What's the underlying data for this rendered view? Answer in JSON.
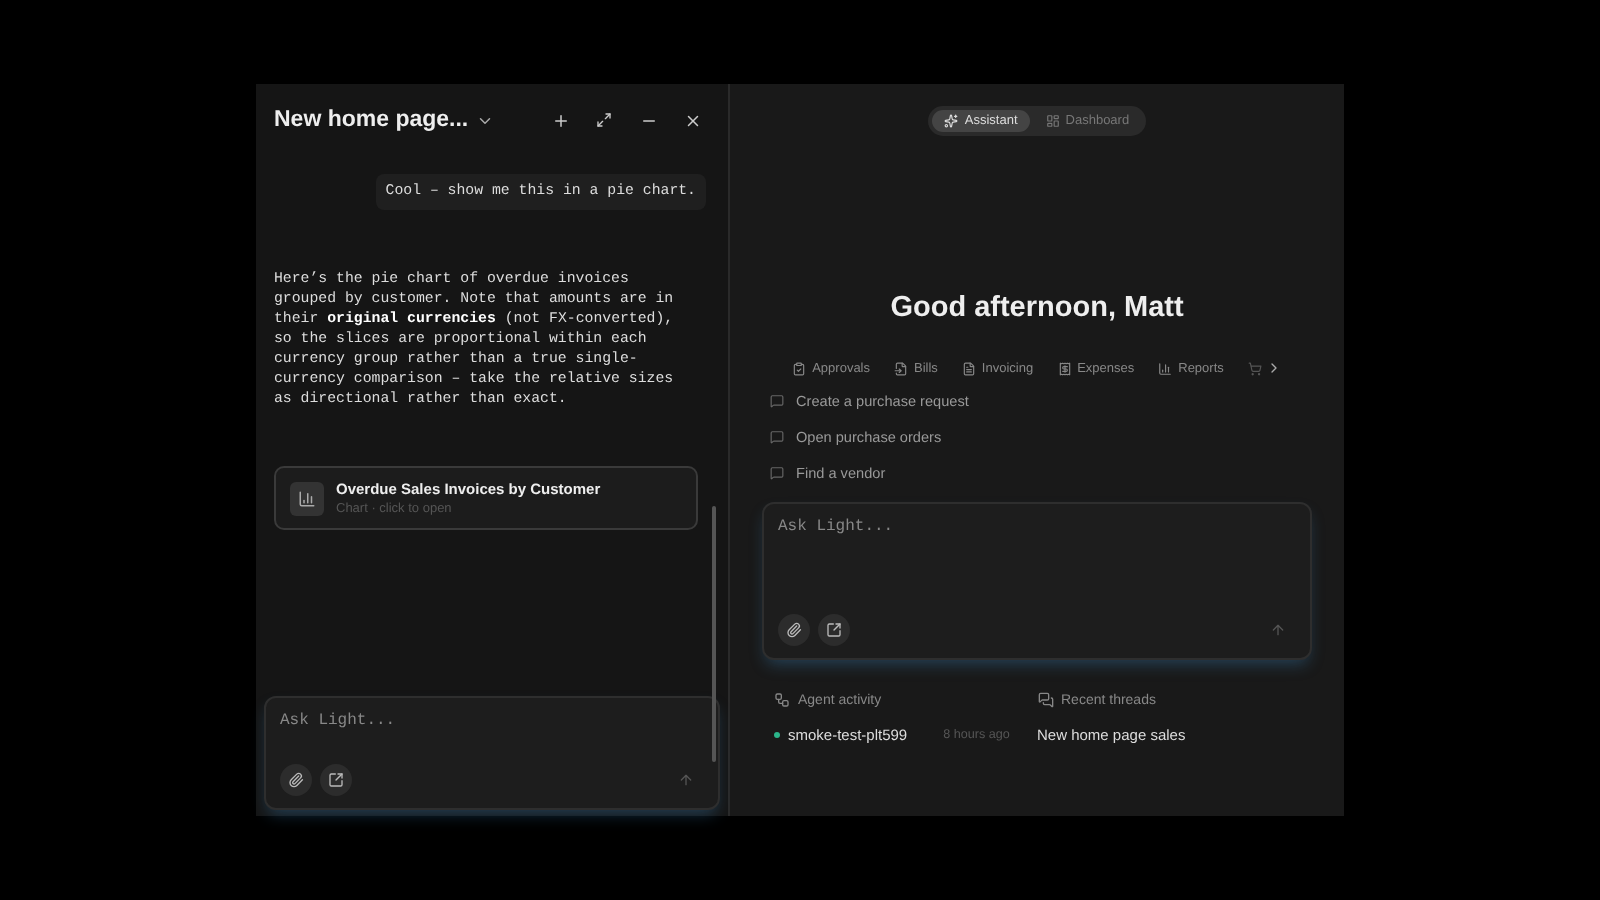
{
  "chat_panel": {
    "title": "New home page...",
    "user_message": "Cool – show me this in a pie chart.",
    "assistant_message": "Here’s the pie chart of overdue invoices grouped by customer. Note that amounts are in their **original currencies** (not FX-converted), so the slices are proportional within each currency group rather than a true single-currency comparison – take the relative sizes as directional rather than exact.",
    "attachment": {
      "title": "Overdue Sales Invoices by Customer",
      "subtitle": "Chart · click to open"
    },
    "composer": {
      "placeholder": "Ask Light..."
    }
  },
  "home": {
    "modes": [
      {
        "label": "Assistant",
        "selected": true
      },
      {
        "label": "Dashboard",
        "selected": false
      }
    ],
    "greeting": "Good afternoon, Matt",
    "shortcuts": [
      "Approvals",
      "Bills",
      "Invoicing",
      "Expenses",
      "Reports"
    ],
    "suggestions": [
      "Create a purchase request",
      "Open purchase orders",
      "Find a vendor"
    ],
    "composer": {
      "placeholder": "Ask Light..."
    },
    "agent_activity": {
      "heading": "Agent activity",
      "items": [
        {
          "name": "smoke-test-plt599",
          "time": "8 hours ago"
        }
      ]
    },
    "recent_threads": {
      "heading": "Recent threads",
      "items": [
        "New home page sales"
      ]
    }
  }
}
